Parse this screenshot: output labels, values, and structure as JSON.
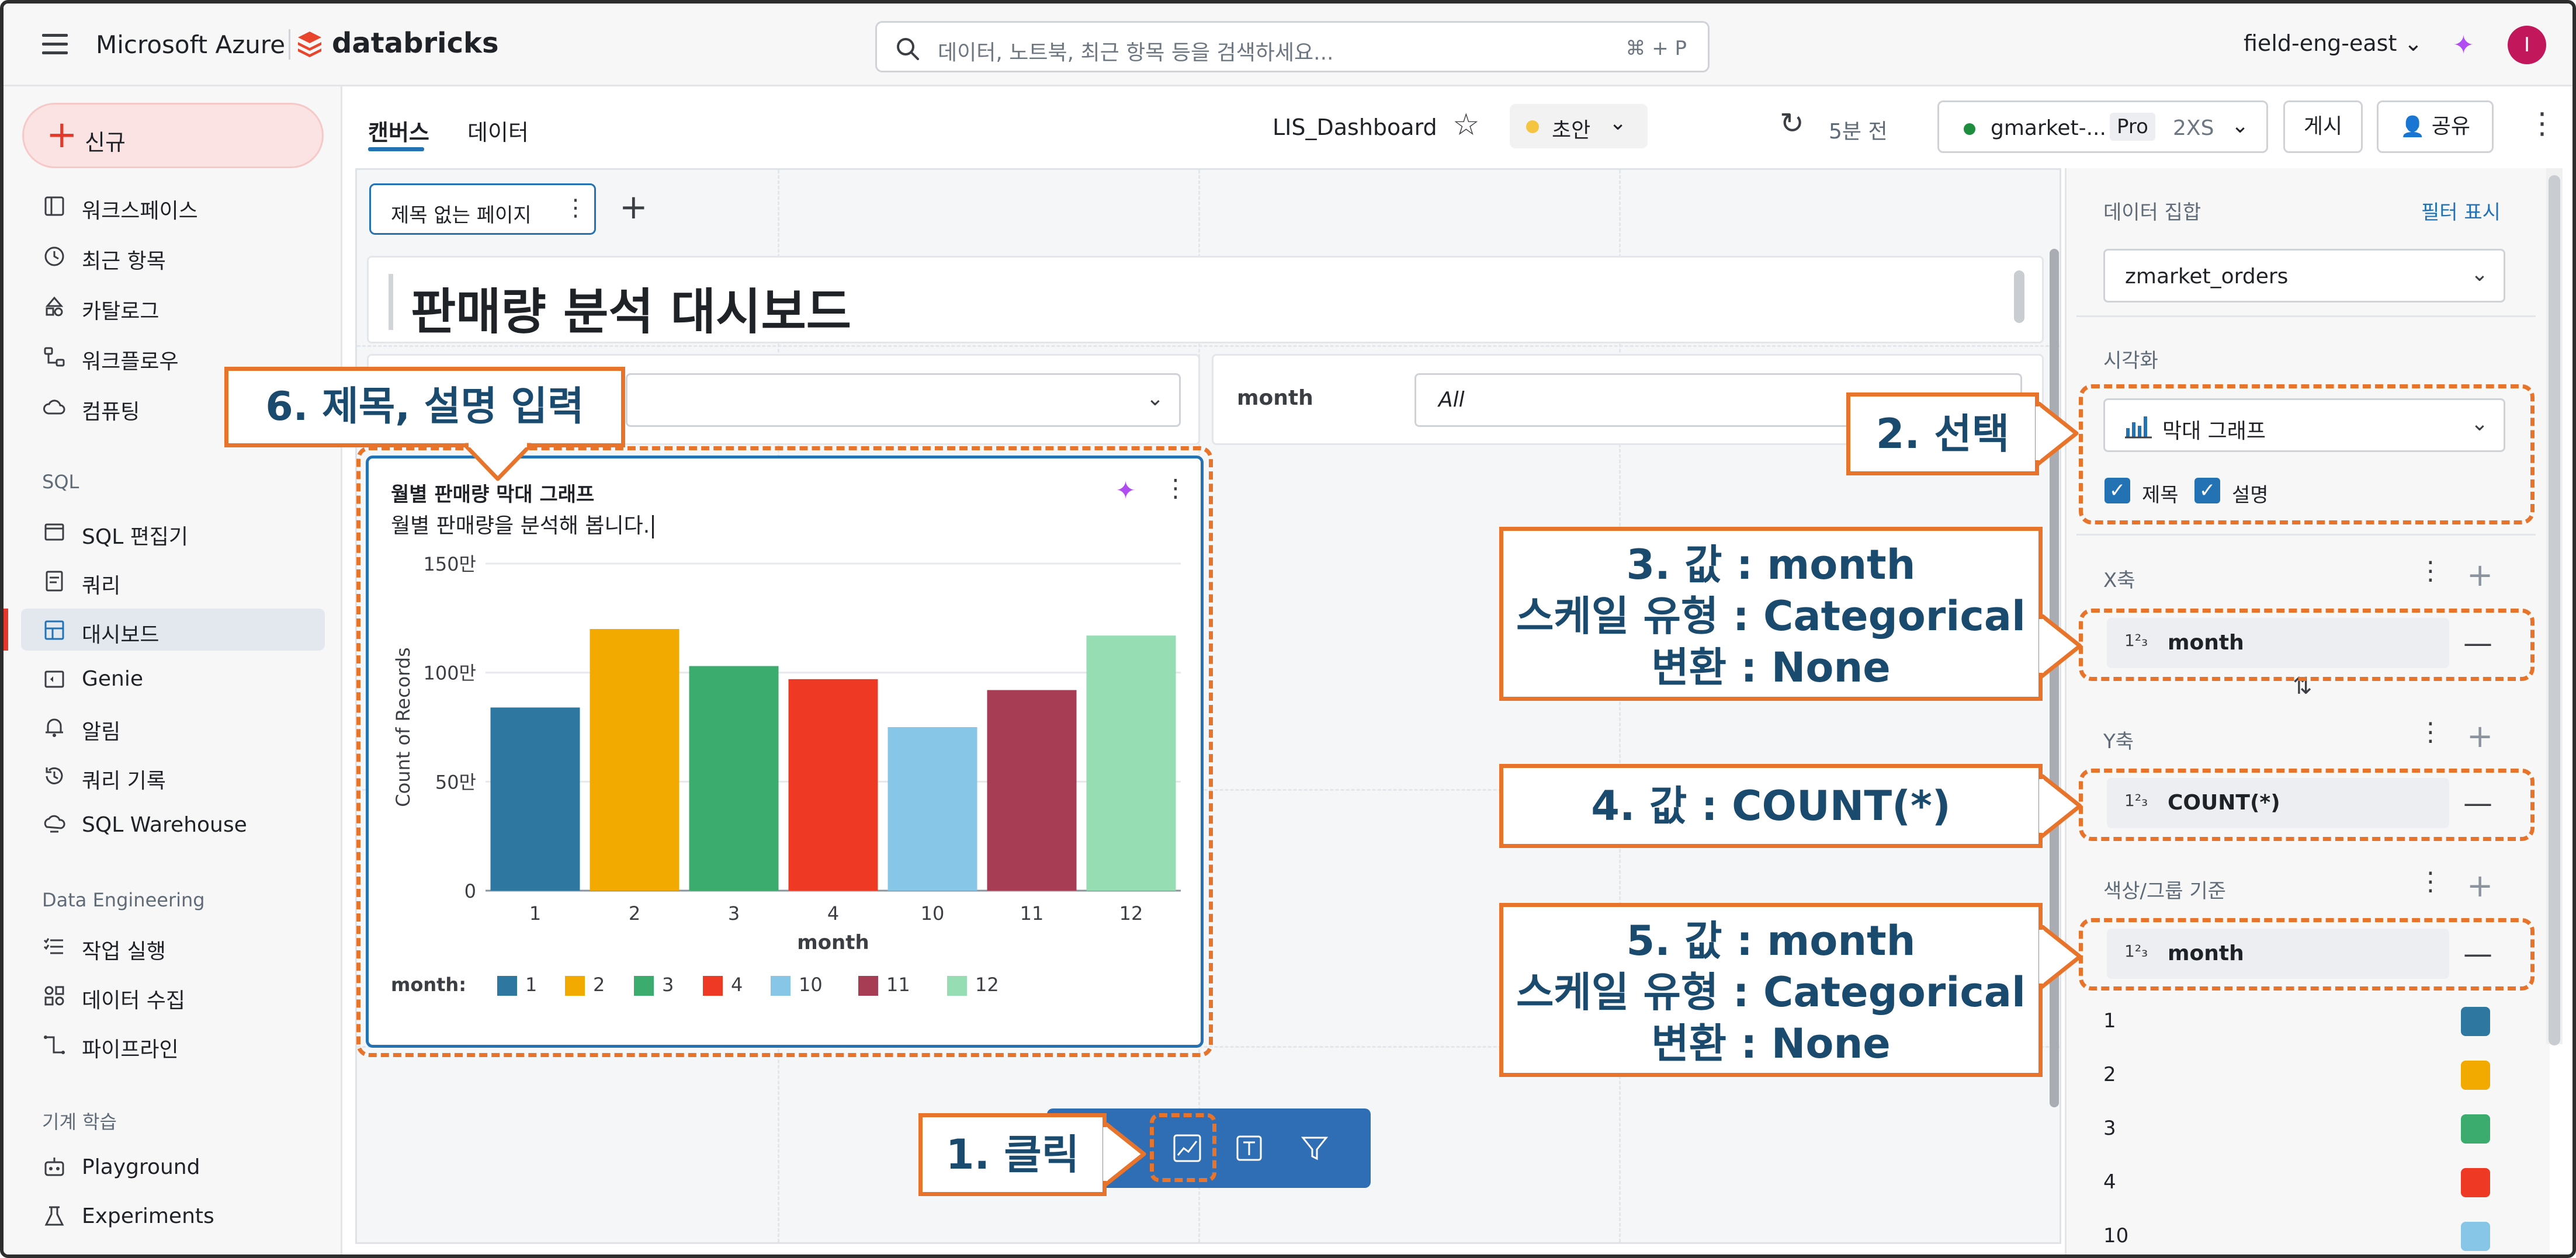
{
  "topbar": {
    "brand_ms": "Microsoft Azure",
    "brand_db": "databricks",
    "search_placeholder": "데이터, 노트북, 최근 항목 등을 검색하세요...",
    "search_shortcut": "⌘ + P",
    "workspace": "field-eng-east",
    "avatar_initial": "I"
  },
  "sidebar": {
    "new_label": "신규",
    "items": [
      {
        "label": "워크스페이스",
        "icon": "workspace-icon"
      },
      {
        "label": "최근 항목",
        "icon": "clock-icon"
      },
      {
        "label": "카탈로그",
        "icon": "catalog-icon"
      },
      {
        "label": "워크플로우",
        "icon": "workflow-icon"
      },
      {
        "label": "컴퓨팅",
        "icon": "cloud-icon"
      }
    ],
    "sql_section": "SQL",
    "sql_items": [
      {
        "label": "SQL 편집기",
        "icon": "sql-editor-icon"
      },
      {
        "label": "쿼리",
        "icon": "query-icon"
      },
      {
        "label": "대시보드",
        "icon": "dashboard-icon",
        "active": true
      },
      {
        "label": "Genie",
        "icon": "genie-icon"
      },
      {
        "label": "알림",
        "icon": "bell-icon"
      },
      {
        "label": "쿼리 기록",
        "icon": "history-icon"
      },
      {
        "label": "SQL Warehouse",
        "icon": "warehouse-icon"
      }
    ],
    "de_section": "Data Engineering",
    "de_items": [
      {
        "label": "작업 실행",
        "icon": "job-runs-icon"
      },
      {
        "label": "데이터 수집",
        "icon": "ingestion-icon"
      },
      {
        "label": "파이프라인",
        "icon": "pipeline-icon"
      }
    ],
    "ml_section": "기계 학습",
    "ml_items": [
      {
        "label": "Playground",
        "icon": "playground-icon"
      },
      {
        "label": "Experiments",
        "icon": "experiments-icon"
      }
    ]
  },
  "header": {
    "tabs": [
      "캔버스",
      "데이터"
    ],
    "dashboard_name": "LIS_Dashboard",
    "draft_label": "초안",
    "refreshed": "5분 전",
    "warehouse_name": "gmarket-...",
    "warehouse_tier": "Pro",
    "warehouse_size": "2XS",
    "publish_label": "게시",
    "share_label": "공유"
  },
  "canvas": {
    "page_tab": "제목 없는 페이지",
    "dashboard_title": "판매량 분석 대시보드",
    "filter_label": "month",
    "filter_value": "All"
  },
  "chart_card": {
    "title": "월별 판매량 막대 그래프",
    "description": "월별 판매량을 분석해 봅니다."
  },
  "chart_data": {
    "type": "bar",
    "categories": [
      "1",
      "2",
      "3",
      "4",
      "10",
      "11",
      "12"
    ],
    "values": [
      840000,
      1200000,
      1030000,
      970000,
      750000,
      920000,
      1170000
    ],
    "colors": [
      "#2e77a0",
      "#f2a900",
      "#3bab6e",
      "#ee3a24",
      "#87c6e6",
      "#a63d55",
      "#96ddb4"
    ],
    "xlabel": "month",
    "ylabel": "Count of Records",
    "ylim": [
      0,
      1500000
    ],
    "y_ticks": [
      0,
      500000,
      1000000,
      1500000
    ],
    "y_tick_labels": [
      "0",
      "50만",
      "100만",
      "150만"
    ],
    "legend_title": "month:",
    "grid": true
  },
  "right_panel": {
    "dataset_label": "데이터 집합",
    "show_filters": "필터 표시",
    "dataset_value": "zmarket_orders",
    "viz_label": "시각화",
    "viz_value": "막대 그래프",
    "title_check": "제목",
    "desc_check": "설명",
    "x_label": "X축",
    "x_field": "month",
    "y_label": "Y축",
    "y_field": "COUNT(*)",
    "color_label": "색상/그룹 기준",
    "color_field": "month",
    "type_glyph": "1²₃",
    "color_legend": [
      {
        "label": "1",
        "color": "#2e77a0"
      },
      {
        "label": "2",
        "color": "#f2a900"
      },
      {
        "label": "3",
        "color": "#3bab6e"
      },
      {
        "label": "4",
        "color": "#ee3a24"
      },
      {
        "label": "10",
        "color": "#87c6e6"
      }
    ]
  },
  "annotations": {
    "c1": "1. 클릭",
    "c2": "2. 선택",
    "c3": [
      "3. 값 : month",
      "스케일 유형 : Categorical",
      "변환 : None"
    ],
    "c4": "4. 값 : COUNT(*)",
    "c5": [
      "5. 값 : month",
      "스케일 유형 : Categorical",
      "변환 : None"
    ],
    "c6": "6. 제목, 설명 입력"
  }
}
